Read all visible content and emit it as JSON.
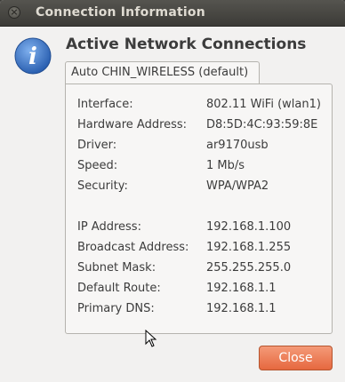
{
  "window": {
    "title": "Connection Information"
  },
  "heading": "Active Network Connections",
  "tab_label": "Auto CHIN_WIRELESS (default)",
  "details": [
    {
      "label": "Interface:",
      "value": "802.11 WiFi (wlan1)"
    },
    {
      "label": "Hardware Address:",
      "value": "D8:5D:4C:93:59:8E"
    },
    {
      "label": "Driver:",
      "value": "ar9170usb"
    },
    {
      "label": "Speed:",
      "value": "1 Mb/s"
    },
    {
      "label": "Security:",
      "value": "WPA/WPA2"
    }
  ],
  "ip_details": [
    {
      "label": "IP Address:",
      "value": "192.168.1.100"
    },
    {
      "label": "Broadcast Address:",
      "value": "192.168.1.255"
    },
    {
      "label": "Subnet Mask:",
      "value": "255.255.255.0"
    },
    {
      "label": "Default Route:",
      "value": "192.168.1.1"
    },
    {
      "label": "Primary DNS:",
      "value": "192.168.1.1"
    }
  ],
  "buttons": {
    "close_label": "Close"
  },
  "icons": {
    "titlebar_close": "close-icon",
    "info": "info-icon",
    "cursor": "cursor-icon"
  },
  "colors": {
    "accent": "#e6683f",
    "titlebar": "#3c3b37",
    "info_icon": "#3a74c8"
  }
}
